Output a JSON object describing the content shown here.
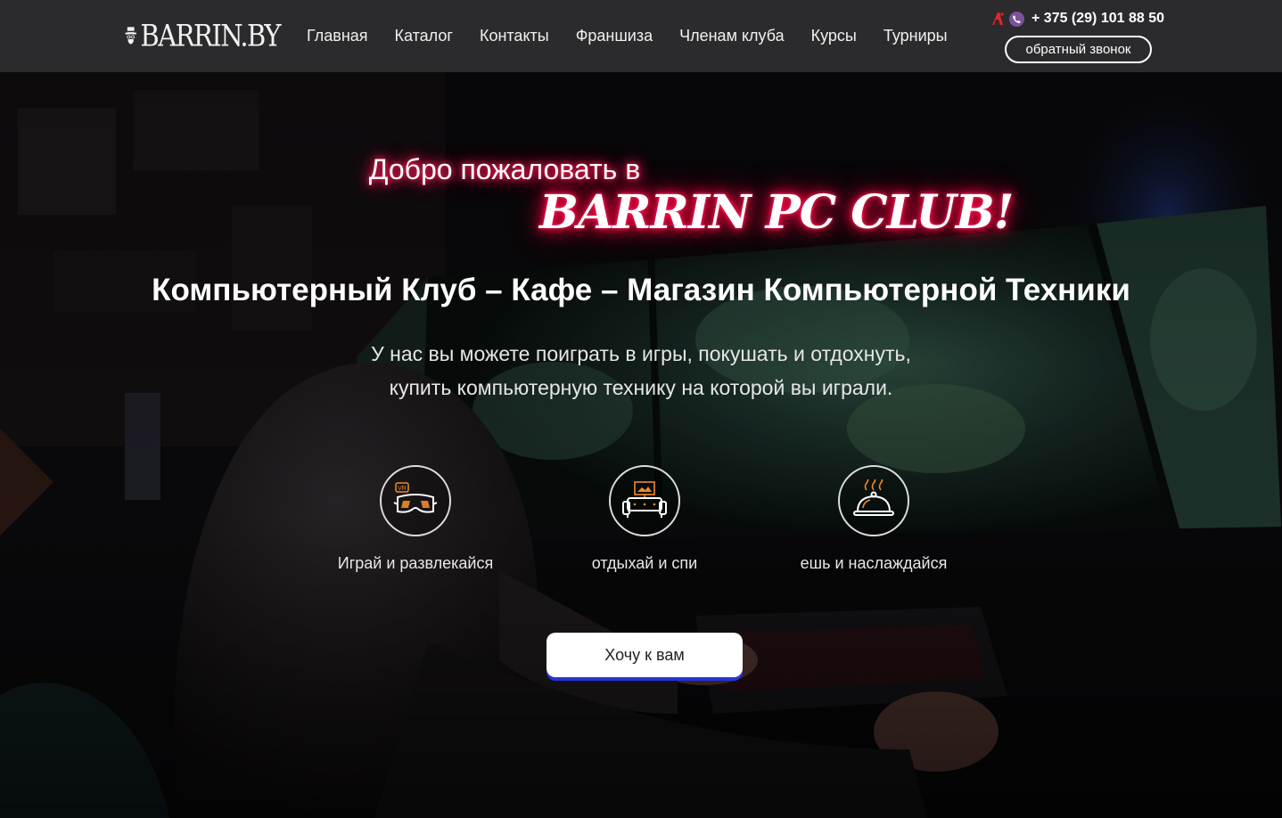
{
  "header": {
    "logo_text": "BARRIN.BY",
    "nav": [
      "Главная",
      "Каталог",
      "Контакты",
      "Франшиза",
      "Членам клуба",
      "Курсы",
      "Турниры"
    ],
    "phone": "+ 375 (29) 101 88 50",
    "callback_label": "обратный звонок"
  },
  "hero": {
    "welcome": "Добро пожаловать в",
    "club_name": "BARRIN PC CLUB!",
    "headline": "Компьютерный Клуб – Кафе – Магазин Компьютерной Техники",
    "subtext_line1": "У нас вы можете поиграть в игры, покушать и отдохнуть,",
    "subtext_line2": "купить компьютерную технику на которой вы играли.",
    "features": [
      {
        "icon": "vr-headset-icon",
        "label": "Играй и развлекайся"
      },
      {
        "icon": "sofa-icon",
        "label": "отдыхай и спи"
      },
      {
        "icon": "cloche-icon",
        "label": "ешь и наслаждайся"
      }
    ],
    "cta_label": "Хочу к вам"
  },
  "colors": {
    "header_bg": "#2b2b2d",
    "neon_pink": "#ff1f5a",
    "icon_orange": "#f08a2a",
    "cta_underline": "#2634d6"
  }
}
